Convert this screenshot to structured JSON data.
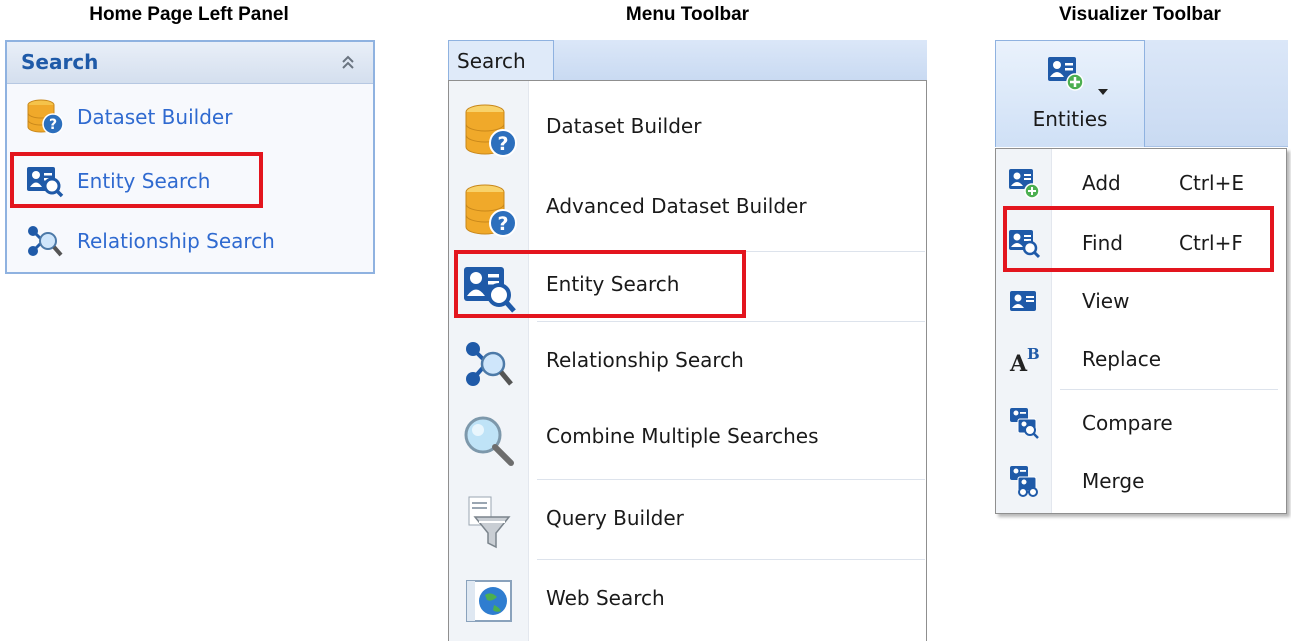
{
  "headings": {
    "left": "Home Page Left Panel",
    "middle": "Menu Toolbar",
    "right": "Visualizer Toolbar"
  },
  "left_panel": {
    "title": "Search",
    "collapse_icon": "double-chevron-up-icon",
    "items": [
      {
        "label": "Dataset Builder",
        "icon": "database-question-icon"
      },
      {
        "label": "Entity Search",
        "icon": "entity-search-icon",
        "highlighted": true
      },
      {
        "label": "Relationship Search",
        "icon": "relationship-search-icon"
      }
    ]
  },
  "menu_toolbar": {
    "tab": "Search",
    "items": [
      {
        "label": "Dataset Builder",
        "icon": "database-question-icon"
      },
      {
        "label": "Advanced Dataset Builder",
        "icon": "database-question-icon"
      },
      {
        "label": "Entity Search",
        "icon": "entity-search-icon",
        "highlighted": true
      },
      {
        "label": "Relationship Search",
        "icon": "relationship-search-icon"
      },
      {
        "label": "Combine Multiple Searches",
        "icon": "magnifier-icon"
      },
      {
        "label": "Query Builder",
        "icon": "funnel-icon"
      },
      {
        "label": "Web Search",
        "icon": "globe-icon"
      }
    ]
  },
  "visualizer_toolbar": {
    "button": "Entities",
    "items": [
      {
        "label": "Add",
        "shortcut": "Ctrl+E",
        "icon": "entity-add-icon"
      },
      {
        "label": "Find",
        "shortcut": "Ctrl+F",
        "icon": "entity-search-icon",
        "highlighted": true
      },
      {
        "label": "View",
        "shortcut": "",
        "icon": "entity-card-icon"
      },
      {
        "label": "Replace",
        "shortcut": "",
        "icon": "replace-icon"
      },
      {
        "label": "Compare",
        "shortcut": "",
        "icon": "compare-icon"
      },
      {
        "label": "Merge",
        "shortcut": "",
        "icon": "merge-icon"
      }
    ]
  },
  "colors": {
    "highlight": "#e3151e",
    "accent_blue": "#2f6ad0",
    "panel_title": "#1f5aa8"
  }
}
